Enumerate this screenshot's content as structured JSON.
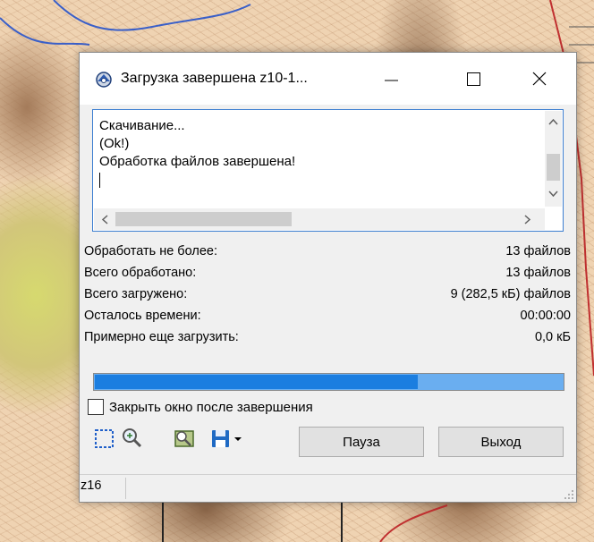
{
  "window": {
    "title": "Загрузка завершена z10-1...",
    "minimize_glyph": "—",
    "maximize_glyph": "☐",
    "close_glyph": "✕"
  },
  "log": {
    "lines": [
      "Скачивание...",
      "(Ok!)",
      "Обработка файлов завершена!"
    ]
  },
  "stats": [
    {
      "label": "Обработать не более:",
      "value": "13 файлов"
    },
    {
      "label": "Всего обработано:",
      "value": "13 файлов"
    },
    {
      "label": "Всего загружено:",
      "value": "9 (282,5 кБ) файлов"
    },
    {
      "label": "Осталось времени:",
      "value": "00:00:00"
    },
    {
      "label": "Примерно еще загрузить:",
      "value": "0,0 кБ"
    }
  ],
  "progress": {
    "fraction": 0.69,
    "fill_color": "#1b7ee0",
    "track_color": "#6aaef0"
  },
  "close_after_finish": {
    "label": "Закрыть окно после завершения",
    "checked": false
  },
  "tools": [
    "select-area-icon",
    "zoom-icon",
    "map-layers-icon",
    "save-icon",
    "dropdown-arrow-icon"
  ],
  "buttons": {
    "pause": "Пауза",
    "exit": "Выход"
  },
  "statusbar": {
    "zoom": "z16"
  }
}
